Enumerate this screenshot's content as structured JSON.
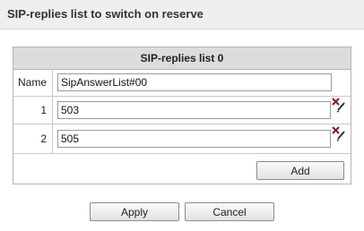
{
  "dialog": {
    "title": "SIP-replies list to switch on reserve"
  },
  "panel": {
    "header": "SIP-replies list 0",
    "name_label": "Name",
    "name_value": "SipAnswerList#00",
    "rows": [
      {
        "index": "1",
        "value": "503"
      },
      {
        "index": "2",
        "value": "505"
      }
    ],
    "add_label": "Add"
  },
  "buttons": {
    "apply": "Apply",
    "cancel": "Cancel"
  },
  "icons": {
    "row_action": "delete-edit-icon"
  },
  "colors": {
    "header_bg": "#dcdcdc",
    "title_bg": "#efefef",
    "delete_x": "#8b1a1a"
  }
}
